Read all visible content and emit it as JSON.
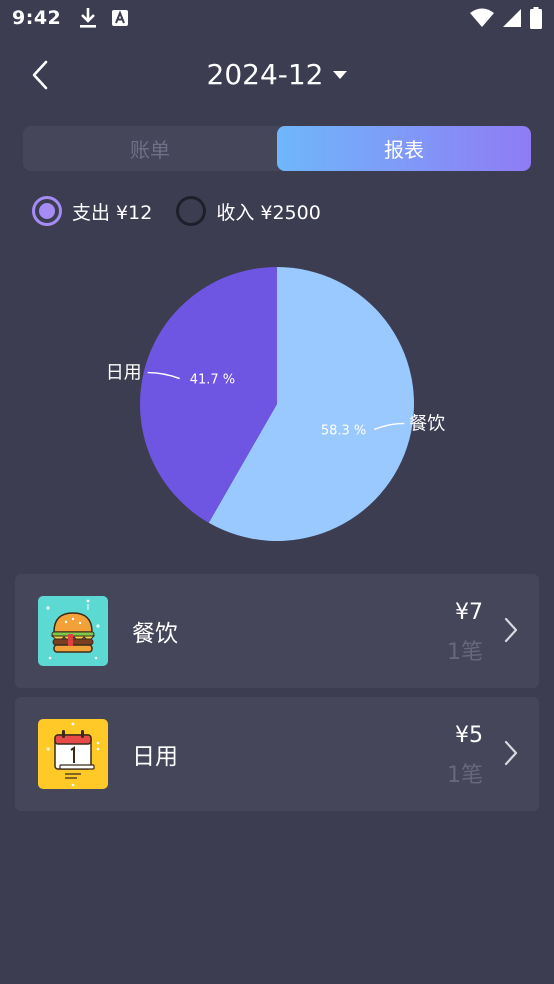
{
  "status_bar": {
    "time": "9:42",
    "left_icons": [
      "download-icon",
      "a-icon"
    ],
    "right_icons": [
      "wifi-icon",
      "signal-icon",
      "battery-icon"
    ]
  },
  "header": {
    "month": "2024-12"
  },
  "tabs": [
    {
      "label": "账单",
      "active": false
    },
    {
      "label": "报表",
      "active": true
    }
  ],
  "type_filter": {
    "expense_label": "支出 ¥12",
    "income_label": "收入 ¥2500",
    "selected": "expense"
  },
  "chart_data": {
    "type": "pie",
    "title": "",
    "slices": [
      {
        "label": "餐饮",
        "value": 58.3,
        "display": "58.3 %",
        "color": "#99c9ff"
      },
      {
        "label": "日用",
        "value": 41.7,
        "display": "41.7 %",
        "color": "#6e55e2"
      }
    ]
  },
  "categories": [
    {
      "name": "餐饮",
      "amount": "¥7",
      "count": "1笔",
      "icon": "burger-icon",
      "icon_bg": "#5dd9d3"
    },
    {
      "name": "日用",
      "amount": "¥5",
      "count": "1笔",
      "icon": "calendar-icon",
      "icon_bg": "#ffc928"
    }
  ],
  "colors": {
    "background": "#3d3d52",
    "card": "#45465a",
    "accent": "#a58cf5",
    "gradient_start": "#6fb7fb",
    "gradient_end": "#8f7cf5"
  }
}
